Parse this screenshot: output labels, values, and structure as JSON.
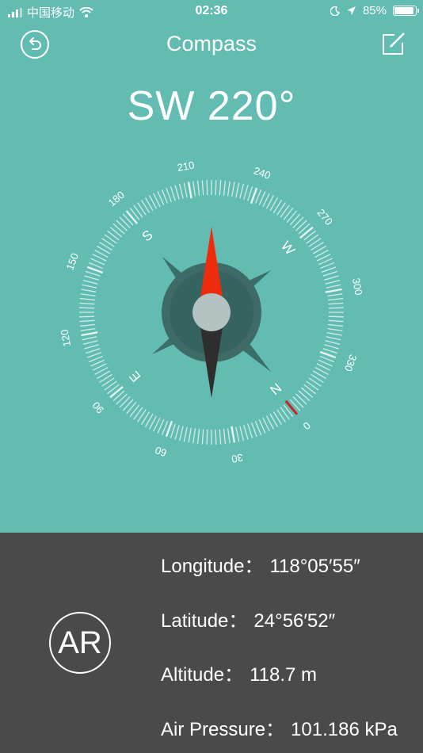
{
  "status_bar": {
    "carrier": "中国移动",
    "time": "02:36",
    "battery": "85%",
    "battery_level": 0.85
  },
  "navbar": {
    "title": "Compass",
    "back_icon": "back-arrow-icon",
    "edit_icon": "edit-icon"
  },
  "heading": {
    "text": "SW 220°",
    "bearing": 220
  },
  "compass": {
    "degree_labels": [
      "0",
      "30",
      "60",
      "90",
      "120",
      "150",
      "180",
      "210",
      "240",
      "270",
      "300",
      "330"
    ],
    "cardinals": [
      "N",
      "E",
      "S",
      "W"
    ],
    "colors": {
      "background": "#62bcb1",
      "needle_north": "#ee2b0c",
      "needle_south": "#2e2e2e",
      "hub": "#b5c2c2",
      "marker": "#cc2222"
    }
  },
  "ar_button": {
    "label": "AR"
  },
  "info": [
    {
      "label": "Longitude：",
      "value": "118°05′55″"
    },
    {
      "label": "Latitude：",
      "value": "24°56′52″"
    },
    {
      "label": "Altitude：",
      "value": "118.7 m"
    },
    {
      "label": "Air Pressure：",
      "value": "101.186 kPa"
    }
  ]
}
